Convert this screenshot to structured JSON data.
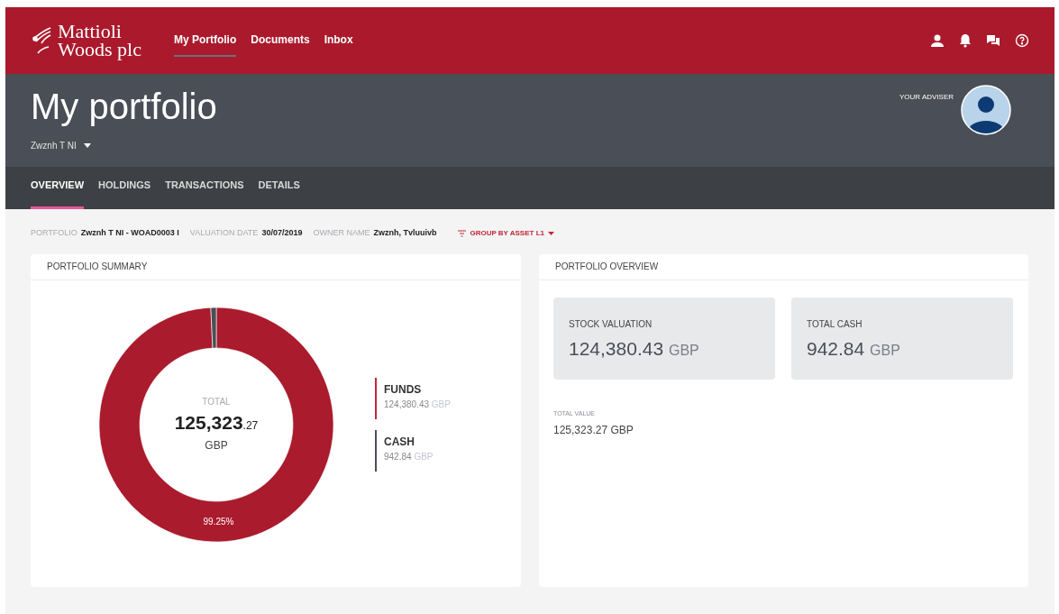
{
  "brand": {
    "line_1": "Mattioli",
    "line_2": "Woods plc"
  },
  "nav": [
    {
      "label": "My Portfolio",
      "selected": true
    },
    {
      "label": "Documents",
      "selected": false
    },
    {
      "label": "Inbox",
      "selected": false
    }
  ],
  "header": {
    "title": "My portfolio",
    "account": "Zwznh T NI",
    "adviser_label": "YOUR ADVISER"
  },
  "tabs": [
    {
      "label": "OVERVIEW",
      "selected": true
    },
    {
      "label": "HOLDINGS",
      "selected": false
    },
    {
      "label": "TRANSACTIONS",
      "selected": false
    },
    {
      "label": "DETAILS",
      "selected": false
    }
  ],
  "info": [
    {
      "label": "PORTFOLIO",
      "value": "Zwznh T NI - WOAD0003 I"
    },
    {
      "label": "VALUATION DATE",
      "value": "30/07/2019"
    },
    {
      "label": "OWNER NAME",
      "value": "Zwznh, Tvluuivb"
    }
  ],
  "group_by": "GROUP BY ASSET L1",
  "summary": {
    "title": "PORTFOLIO SUMMARY",
    "total_label": "TOTAL",
    "total_main": "125,323",
    "total_cents": ".27",
    "total_currency": "GBP",
    "chart_data": {
      "type": "donut",
      "categories": [
        "FUNDS",
        "CASH"
      ],
      "values": [
        99.25,
        0.75
      ],
      "colors": [
        "#a91b2d",
        "#4a4f57"
      ],
      "value_labels": [
        "99.25%",
        null
      ]
    },
    "legend": [
      {
        "amount": "124,380.43",
        "currency": "GBP",
        "color": "#c0273a"
      },
      {
        "amount": "942.84",
        "currency": "GBP",
        "color": "#4a4f57"
      }
    ]
  },
  "overview": {
    "title": "PORTFOLIO OVERVIEW",
    "tiles": [
      {
        "label": "STOCK VALUATION",
        "amount": "124,380.43",
        "currency": "GBP"
      },
      {
        "label": "TOTAL CASH",
        "amount": "942.84",
        "currency": "GBP"
      }
    ],
    "total_label": "TOTAL VALUE",
    "total_value": "125,323.27 GBP"
  }
}
